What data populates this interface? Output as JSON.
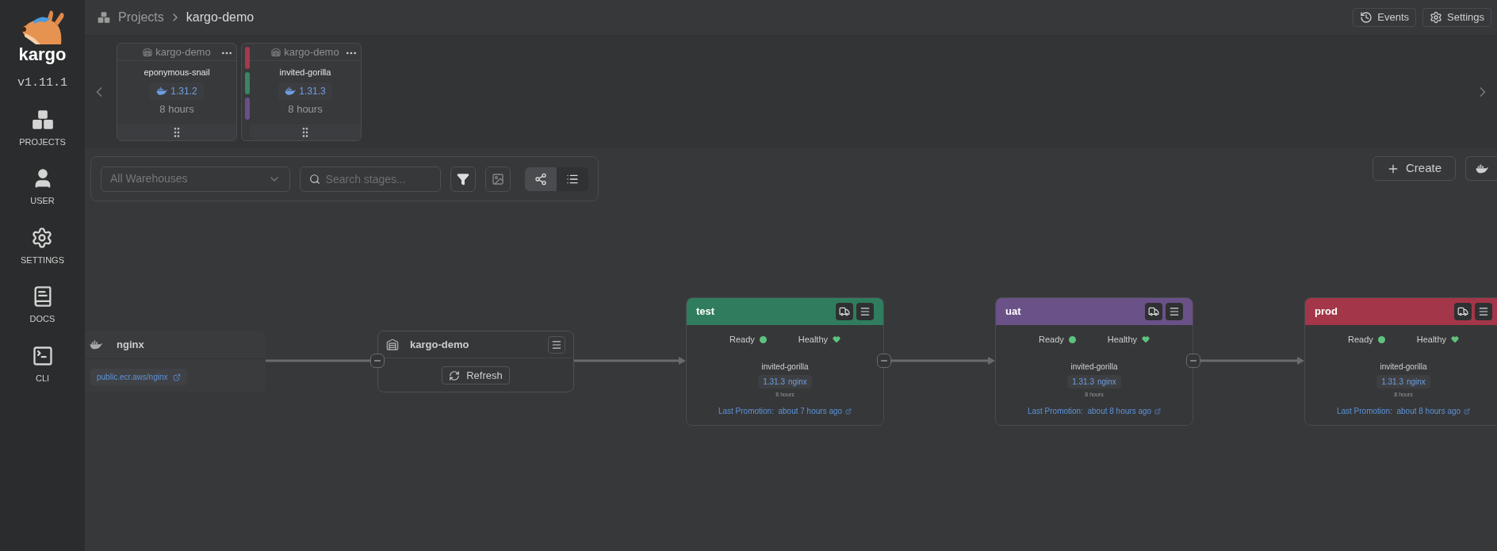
{
  "sidebar": {
    "logo_text": "kargo",
    "version": "v1.11.1",
    "items": [
      {
        "label": "PROJECTS",
        "kind": "projects"
      },
      {
        "label": "USER",
        "kind": "user"
      },
      {
        "label": "SETTINGS",
        "kind": "settings"
      },
      {
        "label": "DOCS",
        "kind": "docs"
      },
      {
        "label": "CLI",
        "kind": "cli"
      }
    ]
  },
  "header": {
    "breadcrumb": [
      "Projects",
      "kargo-demo"
    ],
    "buttons": [
      {
        "label": "Events",
        "kind": "events"
      },
      {
        "label": "Settings",
        "kind": "settings"
      }
    ]
  },
  "freight": [
    {
      "warehouse": "kargo-demo",
      "name": "eponymous-snail",
      "version": "1.31.2",
      "age": "8 hours"
    },
    {
      "warehouse": "kargo-demo",
      "name": "invited-gorilla",
      "version": "1.31.3",
      "age": "8 hours",
      "stages": [
        {
          "color": "#a43a4b"
        },
        {
          "color": "#3a8563"
        },
        {
          "color": "#6a4f87"
        }
      ]
    }
  ],
  "toolbar": {
    "warehouse_select": "All Warehouses",
    "search": {
      "placeholder": "Search stages..."
    },
    "view_modes": [
      {
        "kind": "graph",
        "selected": true
      },
      {
        "kind": "list",
        "selected": false
      }
    ]
  },
  "create_button": "Create",
  "warehouse_node": {
    "name": "nginx",
    "repo": "public.ecr.aws/nginx"
  },
  "project_node": {
    "name": "kargo-demo",
    "refresh": "Refresh"
  },
  "stages": [
    {
      "name": "test",
      "color": "#2f7d5e",
      "ready_label": "Ready",
      "ready": true,
      "health_label": "Healthy",
      "healthy": true,
      "freight": "invited-gorilla",
      "version": "1.31.3",
      "image": "nginx",
      "age": "8 hours",
      "last_promotion": "Last Promotion:  about 7 hours ago"
    },
    {
      "name": "uat",
      "color": "#6a5188",
      "ready_label": "Ready",
      "ready": true,
      "health_label": "Healthy",
      "healthy": true,
      "freight": "invited-gorilla",
      "version": "1.31.3",
      "image": "nginx",
      "age": "8 hours",
      "last_promotion": "Last Promotion:  about 8 hours ago"
    },
    {
      "name": "prod",
      "color": "#a33648",
      "ready_label": "Ready",
      "ready": true,
      "health_label": "Healthy",
      "healthy": true,
      "freight": "invited-gorilla",
      "version": "1.31.3",
      "image": "nginx",
      "age": "8 hours",
      "last_promotion": "Last Promotion:  about 8 hours ago"
    }
  ]
}
